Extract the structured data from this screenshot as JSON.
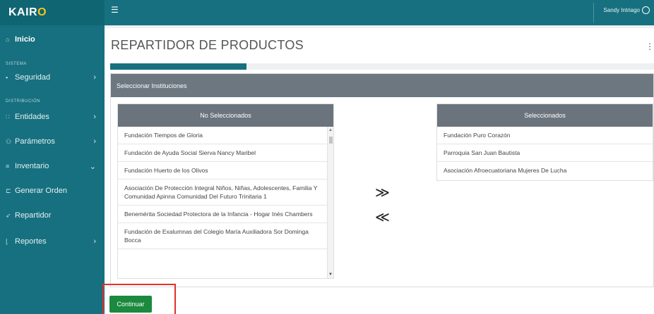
{
  "brand": {
    "name_main": "KAIR",
    "name_accent": "O"
  },
  "user": {
    "name": "Sandy Intriago",
    "icon": "user-circle-icon"
  },
  "sidebar": {
    "items": [
      {
        "label": "Inicio",
        "icon": "home-icon",
        "active": true
      },
      {
        "section": "SISTEMA"
      },
      {
        "label": "Seguridad",
        "icon": "lock-icon",
        "chevron": "›"
      },
      {
        "section": "DISTRIBUCIÓN"
      },
      {
        "label": "Entidades",
        "icon": "sitemap-icon",
        "chevron": "›"
      },
      {
        "label": "Parámetros",
        "icon": "users-icon",
        "chevron": "›"
      },
      {
        "label": "Inventario",
        "icon": "list-icon",
        "chevron": "⌄"
      },
      {
        "label": "Generar Orden",
        "icon": "cart-icon"
      },
      {
        "label": "Repartidor",
        "icon": "send-icon"
      },
      {
        "label": "Reportes",
        "icon": "chart-icon",
        "chevron": "›"
      }
    ]
  },
  "page": {
    "title": "REPARTIDOR DE PRODUCTOS",
    "progress_fraction": 0.25
  },
  "panel": {
    "title": "Seleccionar Instituciones"
  },
  "left_list": {
    "header": "No Seleccionados",
    "items": [
      "Fundación Tiempos de Gloria",
      "Fundación de Ayuda Social Sierva Nancy Maribel",
      "Fundación Huerto de los Olivos",
      "Asociación De Protección Integral Niños, Niñas, Adolescentes, Familia Y Comunidad Apinna Comunidad Del Futuro Trinitaria 1",
      "Benemérita Sociedad Protectora de la Infancia - Hogar Inés Chambers",
      "Fundación de Exalumnas del Colegio María Auxiliadora Sor Dominga Bocca"
    ]
  },
  "right_list": {
    "header": "Seleccionados",
    "items": [
      "Fundación Puro Corazón",
      "Parroquia San Juan Bautista",
      "Asociación Afroecuatoriana Mujeres De Lucha"
    ]
  },
  "transfer": {
    "move_right": "≫",
    "move_left": "≪"
  },
  "actions": {
    "continue_label": "Continuar"
  },
  "colors": {
    "primary": "#17707f",
    "success": "#1b8a3e",
    "highlight": "#e0312a",
    "list_header": "#6b747c"
  }
}
